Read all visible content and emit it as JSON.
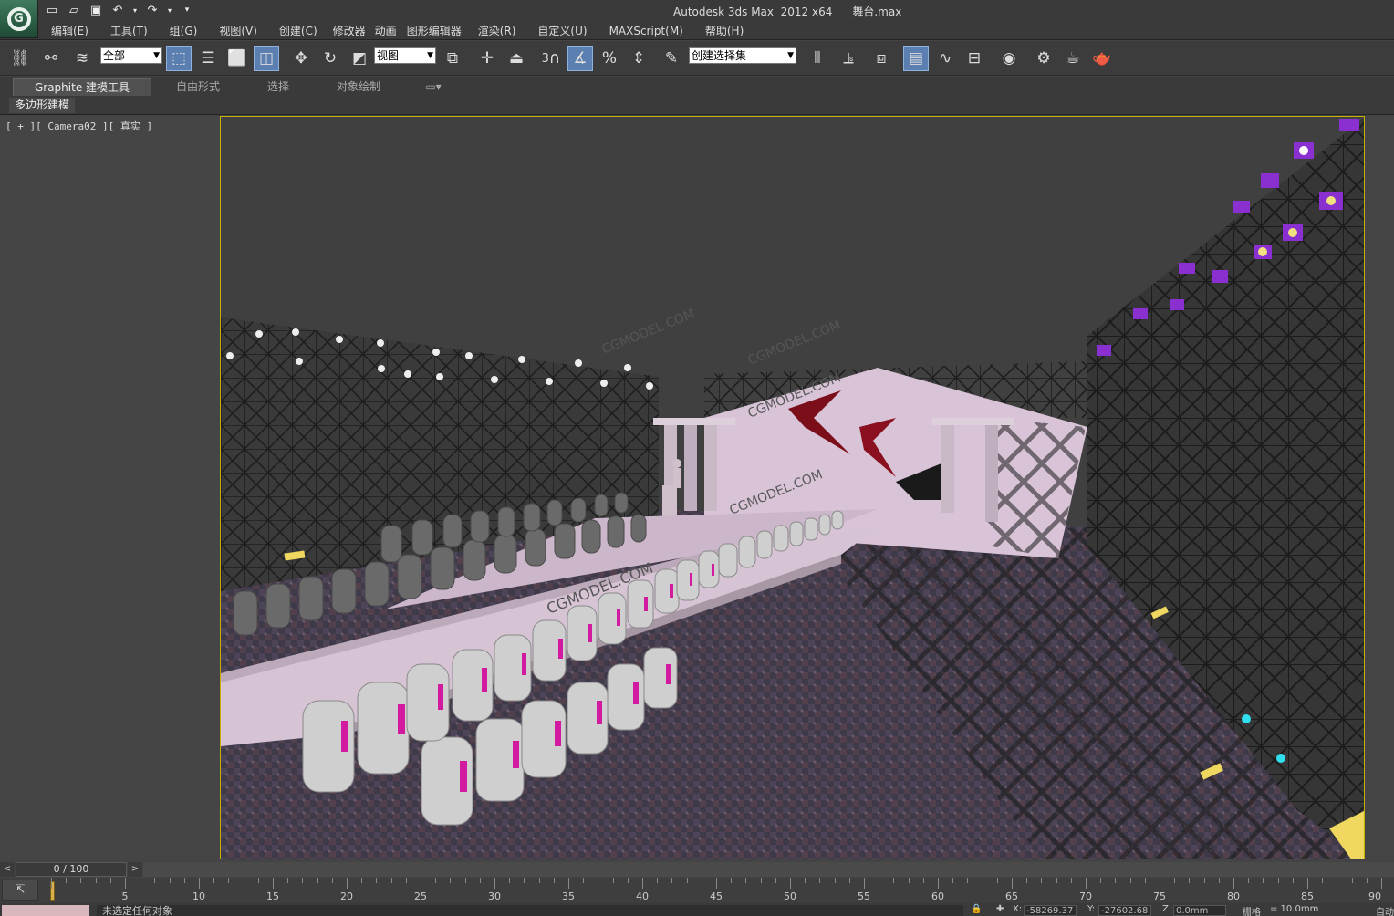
{
  "app": {
    "title": "Autodesk 3ds Max  2012 x64",
    "file": "舞台.max"
  },
  "qat": {
    "icons": [
      "new-file-icon",
      "open-file-icon",
      "save-icon",
      "undo-icon",
      "redo-icon",
      "customize-icon"
    ]
  },
  "menu": [
    "编辑(E)",
    "工具(T)",
    "组(G)",
    "视图(V)",
    "创建(C)",
    "修改器",
    "动画",
    "图形编辑器",
    "渲染(R)",
    "自定义(U)",
    "MAXScript(M)",
    "帮助(H)"
  ],
  "toolbar": {
    "selection_filter": "全部",
    "ref_coord": "视图",
    "named_selection": "创建选择集",
    "snap_label": "3"
  },
  "ribbon": {
    "tabs": [
      "Graphite 建模工具",
      "自由形式",
      "选择",
      "对象绘制"
    ],
    "panel_label": "多边形建模"
  },
  "viewport": {
    "label": "[ + ][ Camera02 ][ 真实 ]",
    "watermark": "CGMODEL.COM"
  },
  "timeslider": {
    "position": "0 / 100",
    "prev": "<",
    "next": ">"
  },
  "trackbar": {
    "ticks": [
      "5",
      "10",
      "15",
      "20",
      "25",
      "30",
      "35",
      "40",
      "45",
      "50",
      "55",
      "60",
      "65",
      "70",
      "75",
      "80",
      "85",
      "90"
    ]
  },
  "status": {
    "prompt": "未选定任何对象",
    "x_label": "X:",
    "x_value": "-58269.37",
    "y_label": "Y:",
    "y_value": "-27602.68",
    "z_label": "Z:",
    "z_value": "0.0mm",
    "grid_label": "栅格",
    "grid_value": "= 10.0mm",
    "autokey": "自动"
  },
  "colors": {
    "accent": "#c9b000",
    "active_button": "#5a7fb0",
    "stage_pink": "#d8c4d6",
    "truss_purple": "#8a2fd0",
    "chair_sash": "#d21aa0"
  }
}
